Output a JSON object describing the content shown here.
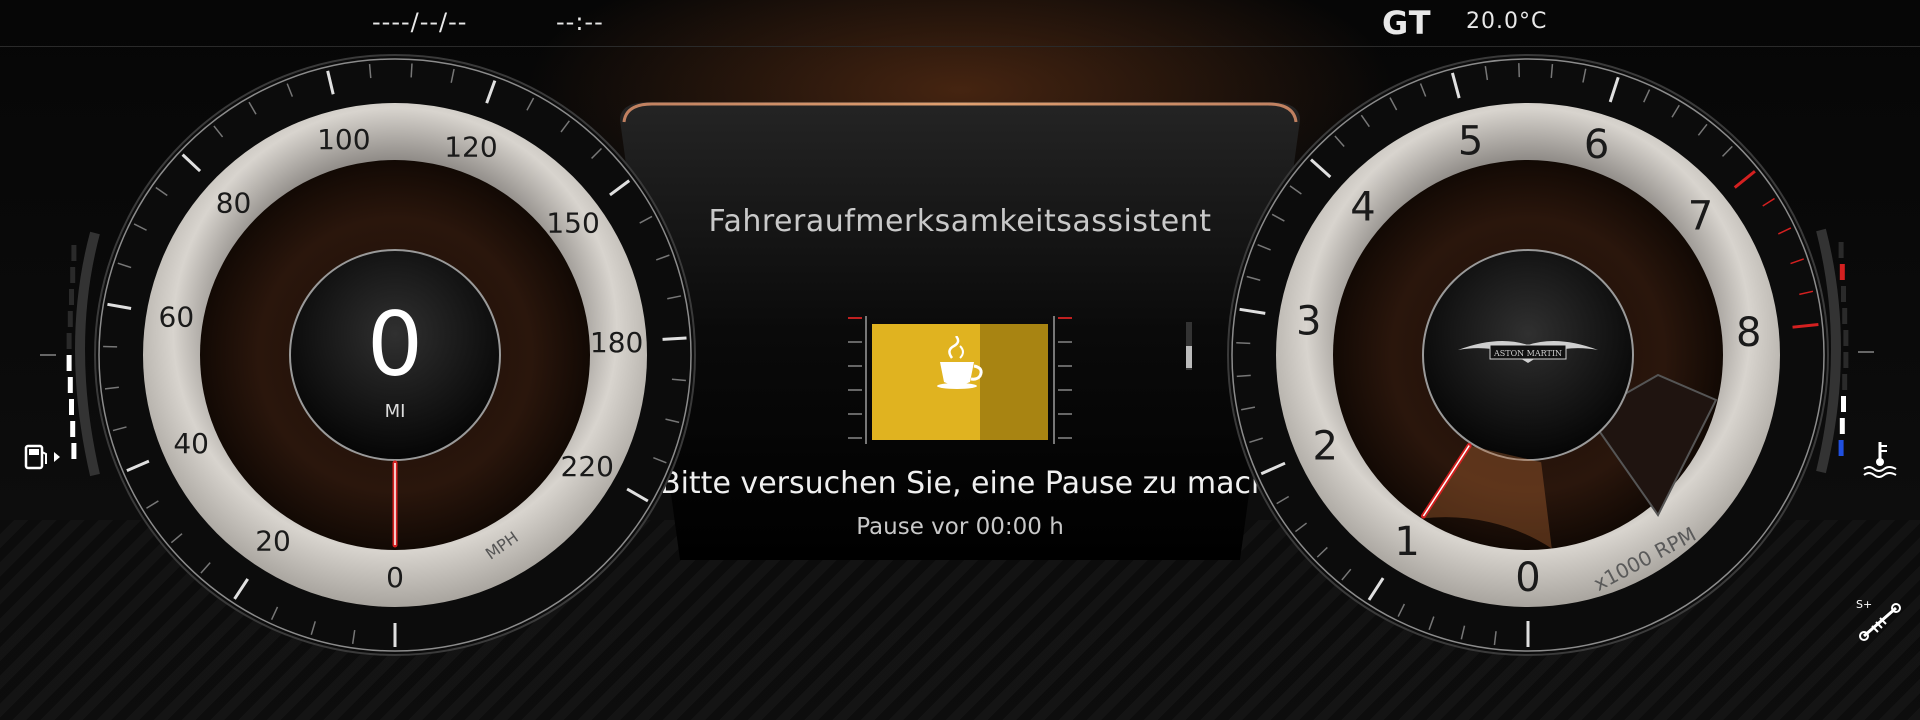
{
  "topbar": {
    "date": "----/--/--",
    "time": "--:--",
    "drive_mode": "GT",
    "outside_temp": "20.0°C"
  },
  "speedometer": {
    "value": "0",
    "odometer_unit": "MI",
    "unit_label": "MPH",
    "scale_labels": [
      "0",
      "20",
      "40",
      "60",
      "80",
      "100",
      "120",
      "150",
      "180",
      "220"
    ],
    "current_speed": 0
  },
  "tachometer": {
    "scale_labels": [
      "0",
      "1",
      "2",
      "3",
      "4",
      "5",
      "6",
      "7",
      "8"
    ],
    "unit_label": "x1000 RPM",
    "brand": "ASTON MARTIN",
    "current_rpm_x1000": 1,
    "redline_from_x1000": 7
  },
  "center_panel": {
    "title": "Fahreraufmerksamkeitsassistent",
    "message": "Bitte versuchen Sie, eine Pause zu machen",
    "pause_text": "Pause vor 00:00 h",
    "icon": "coffee-cup-icon",
    "accent": "#e0b320"
  },
  "indicators": {
    "fuel_icon": "fuel-pump-icon",
    "fuel_level_fraction": 0.5,
    "coolant_icon": "coolant-temperature-icon",
    "suspension_icon": "suspension-sport-plus-icon",
    "suspension_label": "S+"
  },
  "colors": {
    "needle": "#d42020",
    "redline": "#d42020",
    "cold": "#2050e0",
    "glow": "#c0703a"
  }
}
